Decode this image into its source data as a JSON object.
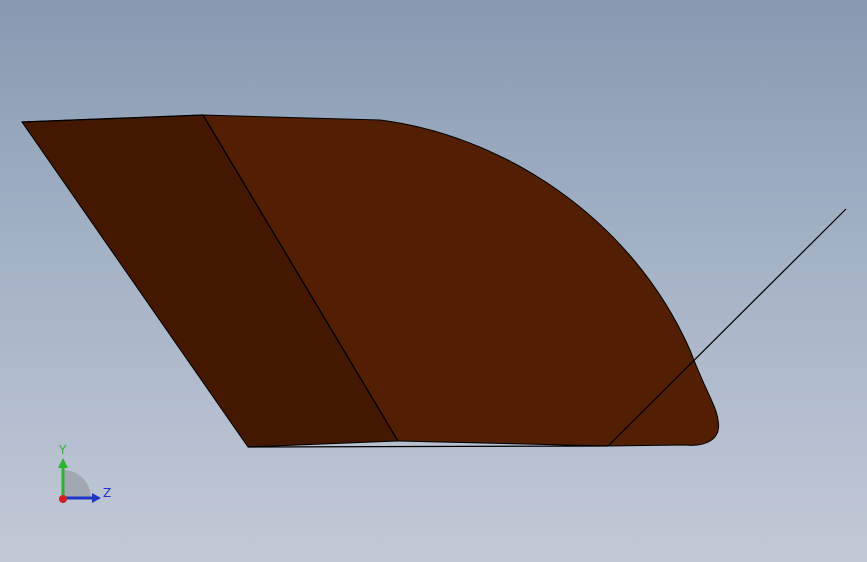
{
  "viewport": {
    "background_top": "#8799b1",
    "background_bottom": "#c2c9d6"
  },
  "model": {
    "face_colors": {
      "main": "#521f02",
      "side": "#441800",
      "edge": "#000000"
    }
  },
  "triad": {
    "y_label": "Y",
    "z_label": "Z",
    "y_color": "#2bb52b",
    "z_color": "#1f35c9",
    "x_color": "#d21e1e"
  }
}
